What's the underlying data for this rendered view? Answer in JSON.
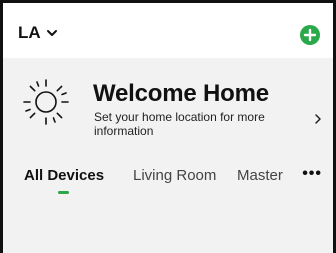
{
  "header": {
    "location_label": "LA",
    "location_chevron_icon": "chevron-down-icon",
    "add_icon": "plus-circle-icon"
  },
  "welcome": {
    "title": "Welcome Home",
    "subtitle": "Set your home location for more information",
    "weather_icon": "sun-icon",
    "arrow_icon": "chevron-right-icon"
  },
  "tabs": {
    "items": [
      {
        "label": "All Devices",
        "active": true
      },
      {
        "label": "Living Room",
        "active": false
      },
      {
        "label": "Master",
        "active": false
      }
    ],
    "more_label": "•••"
  },
  "colors": {
    "accent": "#2aa84a",
    "background": "#f2f2f2",
    "header_background": "#ffffff"
  }
}
